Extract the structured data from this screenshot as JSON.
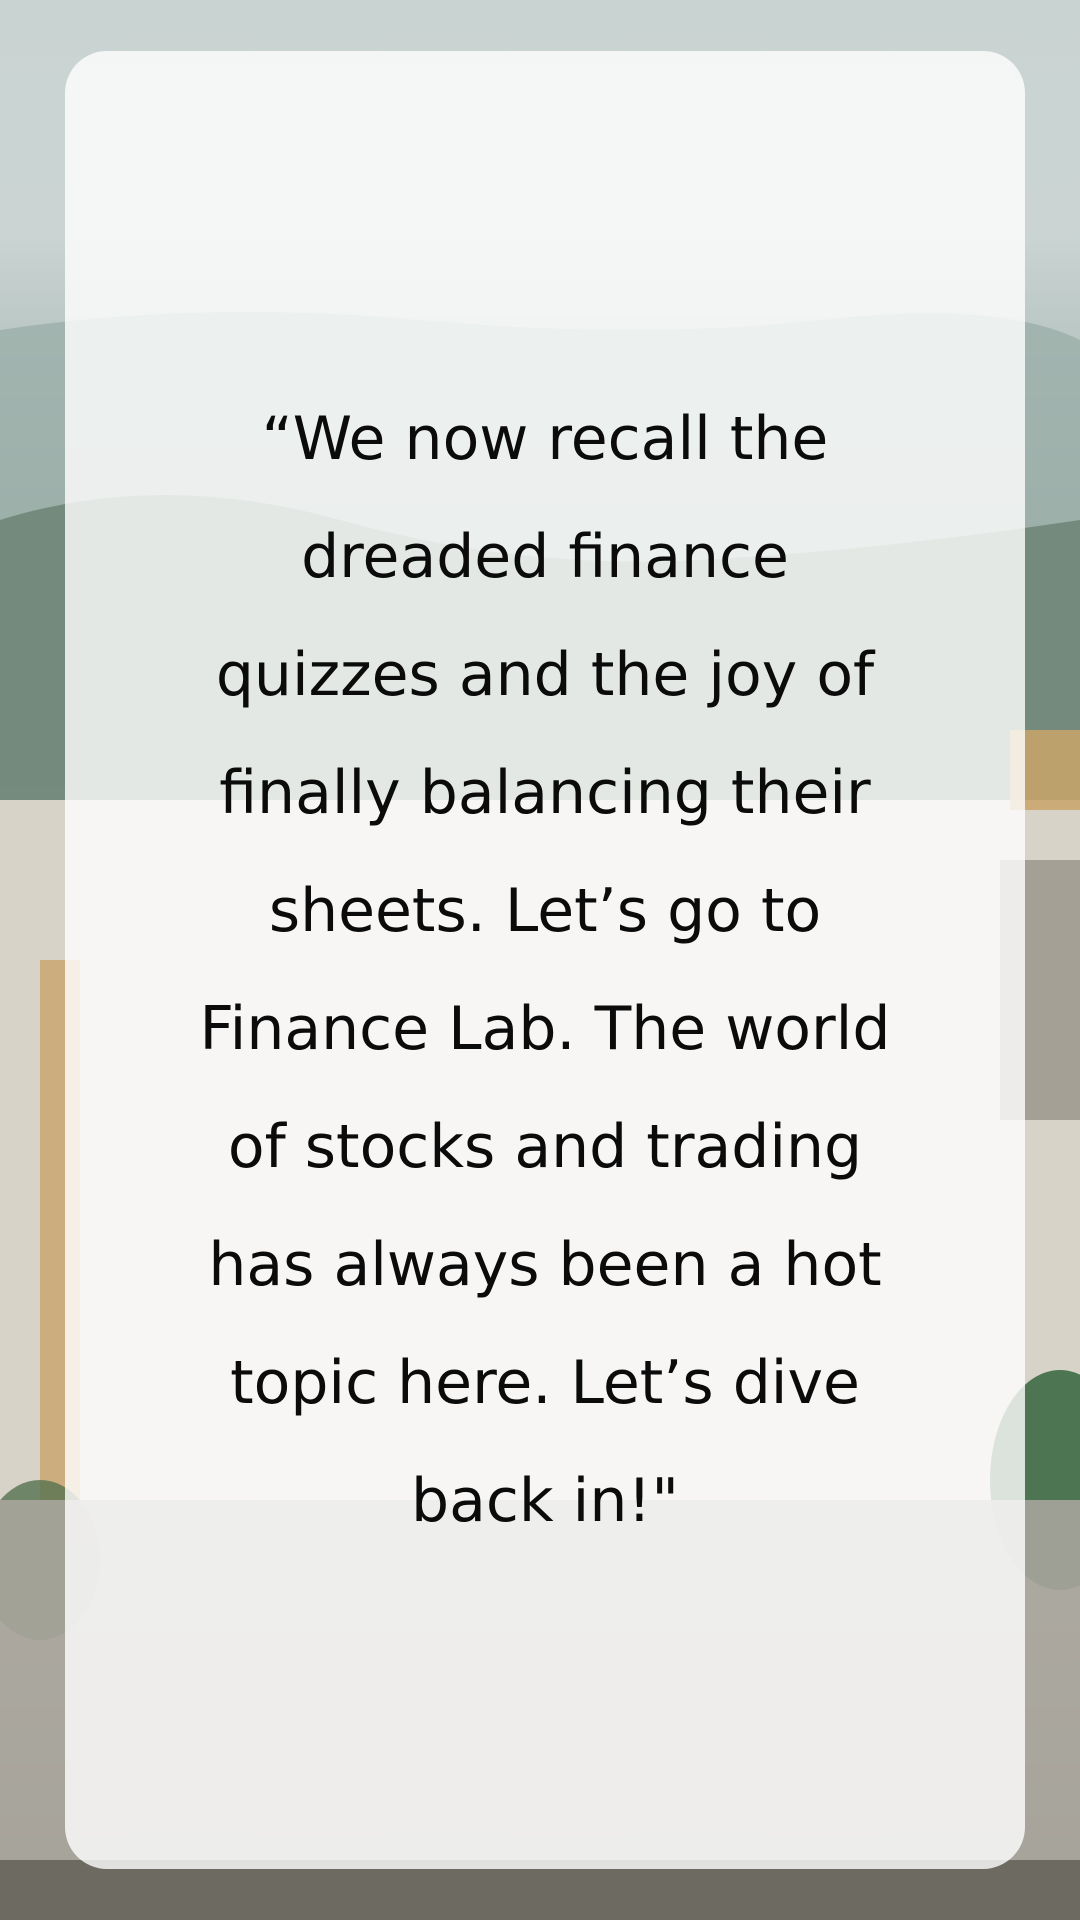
{
  "quote": {
    "lines": [
      "“We now recall the",
      "dreaded finance",
      "quizzes and the joy of",
      "finally balancing their",
      "sheets. Let’s go to",
      "Finance Lab. The world",
      "of stocks and trading",
      "has always been a hot",
      "topic here. Let’s dive",
      "back in!\""
    ]
  },
  "colors": {
    "card": "#ffffff",
    "text": "#0b0b0b",
    "sky": "#c9d3d2",
    "hills": "#7f9489",
    "building": "#d6d2c8",
    "accent_wood": "#c9a46a"
  }
}
